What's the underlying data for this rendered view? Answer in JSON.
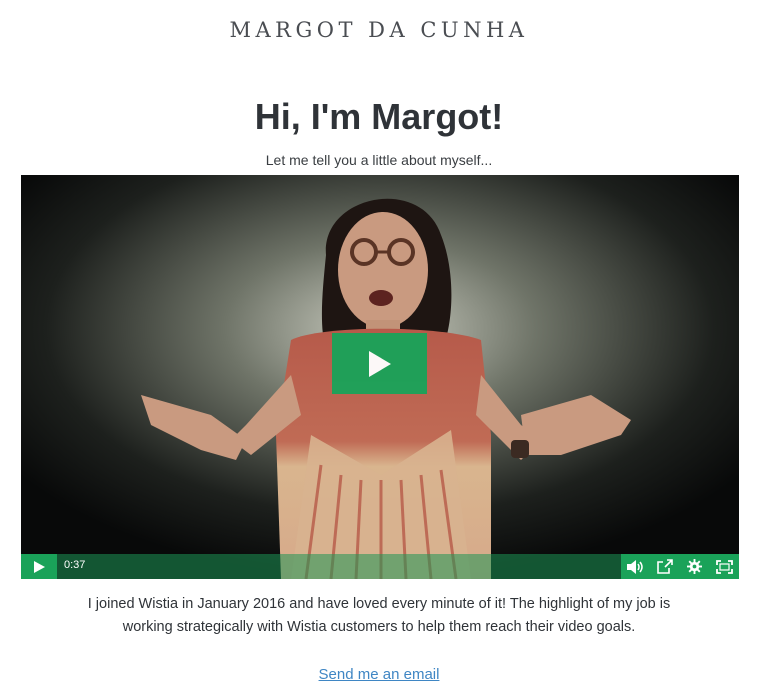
{
  "site": {
    "name": "MARGOT DA CUNHA"
  },
  "hero": {
    "headline": "Hi, I'm Margot!",
    "subtitle": "Let me tell you a little about myself..."
  },
  "video": {
    "current_time": "0:37",
    "accent_color": "#1aa259",
    "controls": [
      "play-icon",
      "volume-icon",
      "share-icon",
      "settings-icon",
      "fullscreen-icon"
    ]
  },
  "bio": {
    "line1": "I joined Wistia in January 2016 and have loved every minute of it! The highlight of my job is",
    "line2": "working strategically with Wistia customers to help them reach their video goals."
  },
  "contact": {
    "email_link_label": "Send me an email"
  }
}
